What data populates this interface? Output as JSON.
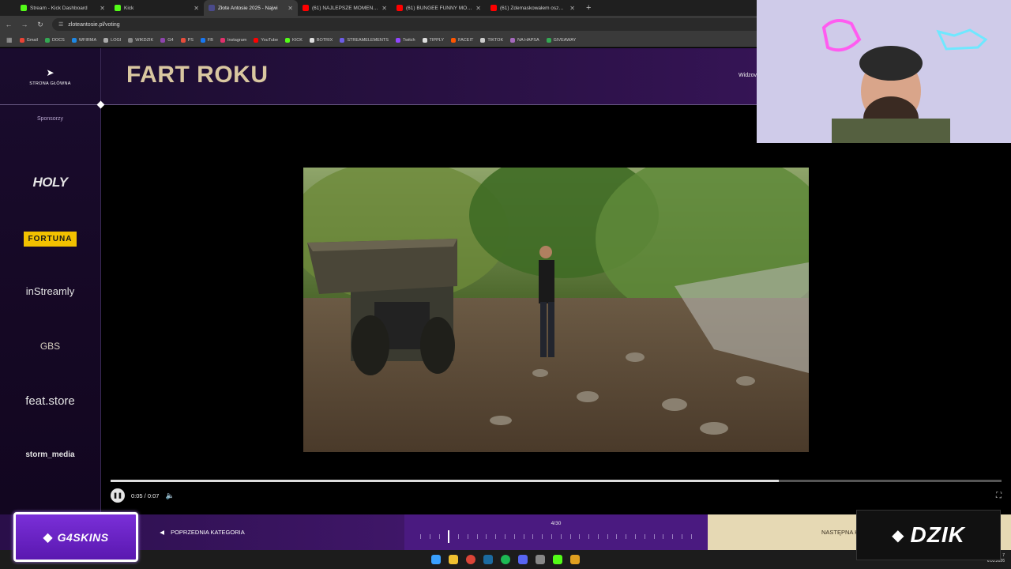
{
  "browser": {
    "tabs": [
      {
        "label": "Stream - Kick Dashboard",
        "color": "#53fc18",
        "active": false
      },
      {
        "label": "Kick",
        "color": "#53fc18",
        "active": false
      },
      {
        "label": "Złote Antosie 2025 - Najwi",
        "color": "#4a4a8a",
        "active": true
      },
      {
        "label": "(61) NAJLEPSZE MOMENTY PO",
        "color": "#ff0000",
        "active": false
      },
      {
        "label": "(61) BUNGEE FUNNY MOMENT",
        "color": "#ff0000",
        "active": false
      },
      {
        "label": "(61) Zdemaskowałem oszustó",
        "color": "#ff0000",
        "active": false
      }
    ],
    "new_tab": "+",
    "url": "zloteantosie.pl/voting",
    "bookmarks": [
      {
        "label": "Gmail",
        "color": "#ea4335"
      },
      {
        "label": "DOCS",
        "color": "#34a853"
      },
      {
        "label": "WFIRMA",
        "color": "#1e88e5"
      },
      {
        "label": "LOGI",
        "color": "#aaaaaa"
      },
      {
        "label": "WIKDZIK",
        "color": "#888888"
      },
      {
        "label": "G4",
        "color": "#8e44ad"
      },
      {
        "label": "PS",
        "color": "#e74c3c"
      },
      {
        "label": "FB",
        "color": "#1877f2"
      },
      {
        "label": "Instagram",
        "color": "#e1306c"
      },
      {
        "label": "YouTube",
        "color": "#ff0000"
      },
      {
        "label": "KICK",
        "color": "#53fc18"
      },
      {
        "label": "BOTRIX",
        "color": "#dddddd"
      },
      {
        "label": "STREAMELEMENTS",
        "color": "#6c5ce7"
      },
      {
        "label": "Twitch",
        "color": "#9146ff"
      },
      {
        "label": "TIPPLY",
        "color": "#dddddd"
      },
      {
        "label": "FACEIT",
        "color": "#ff5500"
      },
      {
        "label": "TIKTOK",
        "color": "#cccccc"
      },
      {
        "label": "NA HAPSA",
        "color": "#a569bd"
      },
      {
        "label": "GIVEAWAY",
        "color": "#34a853"
      }
    ]
  },
  "sidebar": {
    "home_label": "STRONA GŁÓWNA",
    "sponsors_title": "Sponsorzy",
    "sponsors": {
      "holy": "HOLY",
      "fortuna": "FORTUNA",
      "instreamly": "inStreamly",
      "gbs": "GBS",
      "feat": "feat.store",
      "storm": "storm_media"
    }
  },
  "header": {
    "title": "FART ROKU",
    "viewer_label": "Widzov"
  },
  "player": {
    "time": "0:05 / 0:07",
    "progress": 0.75
  },
  "bottom": {
    "prev_label": "POPRZEDNIA KATEGORIA",
    "counter": "4/30",
    "current_index": 4,
    "total": 30,
    "next_label": "NASTĘPNA K"
  },
  "overlays": {
    "g4skins": "G4SKINS",
    "dzik": "DZIK"
  },
  "taskbar": {
    "time": "7",
    "date": "6.03.2026"
  }
}
